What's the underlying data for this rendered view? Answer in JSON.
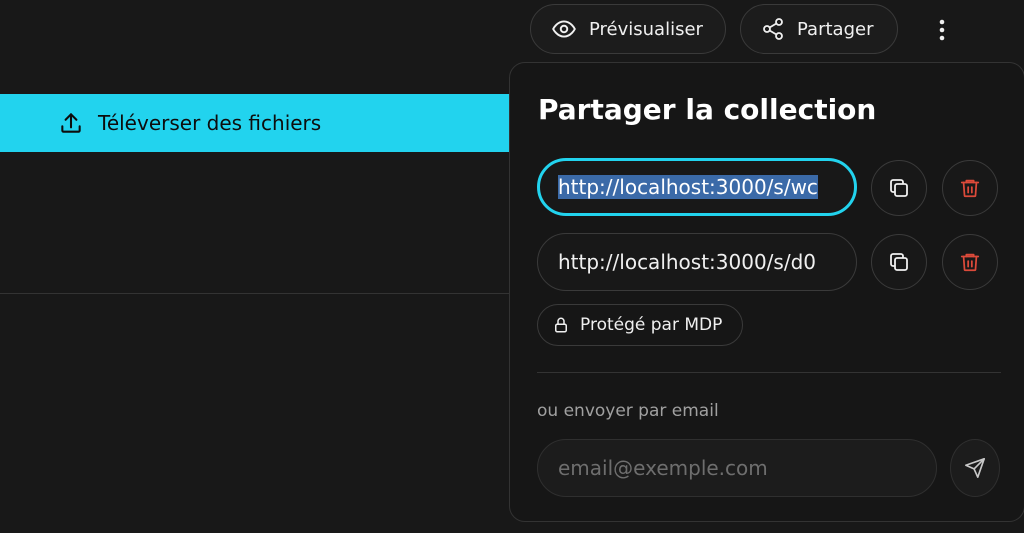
{
  "toolbar": {
    "preview_label": "Prévisualiser",
    "share_label": "Partager",
    "more_icon": "kebab-vertical-icon"
  },
  "upload": {
    "label": "Téléverser des fichiers",
    "icon": "upload-icon"
  },
  "share_panel": {
    "title": "Partager la collection",
    "links": [
      {
        "url": "http://localhost:3000/s/wc",
        "focused": true,
        "selected": true
      },
      {
        "url": "http://localhost:3000/s/d0",
        "focused": false,
        "selected": false
      }
    ],
    "copy_icon": "copy-icon",
    "delete_icon": "trash-icon",
    "password_badge": "Protégé par MDP",
    "email_label": "ou envoyer par email",
    "email_placeholder": "email@exemple.com",
    "email_value": "",
    "send_icon": "send-icon"
  },
  "colors": {
    "accent": "#22d3ee",
    "background": "#181818",
    "delete": "#dc4a3a",
    "selection": "#3b6aa8"
  }
}
